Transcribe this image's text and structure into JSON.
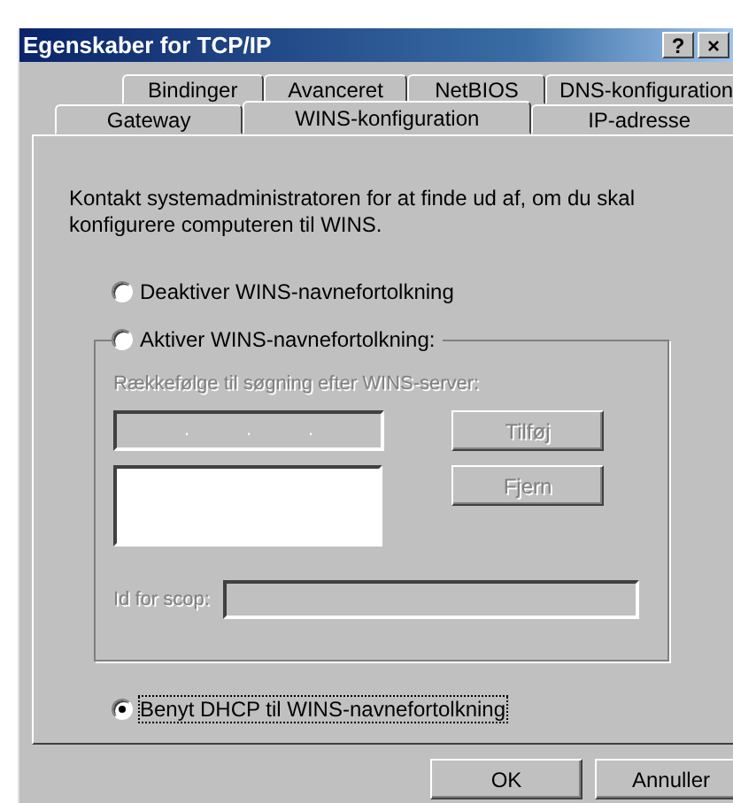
{
  "window": {
    "title": "Egenskaber for TCP/IP",
    "help_button": "?",
    "close_button": "×"
  },
  "tabs": [
    [
      {
        "label": "Bindinger",
        "selected": false
      },
      {
        "label": "Avanceret",
        "selected": false
      },
      {
        "label": "NetBIOS",
        "selected": false
      },
      {
        "label": "DNS-konfiguration",
        "selected": false
      }
    ],
    [
      {
        "label": "Gateway",
        "selected": false
      },
      {
        "label": "WINS-konfiguration",
        "selected": true
      },
      {
        "label": "IP-adresse",
        "selected": false
      }
    ]
  ],
  "intro": "Kontakt systemadministratoren for at finde ud af, om du skal konfigurere computeren til WINS.",
  "radios": [
    {
      "label": "Deaktiver WINS-navnefortolkning",
      "selected": false
    },
    {
      "label": "Aktiver WINS-navnefortolkning:",
      "selected": false
    }
  ],
  "wins_group": {
    "disabled": true,
    "server_label": "Rækkefølge til søgning efter WINS-server:",
    "ip_dots": [
      ".",
      ".",
      "."
    ],
    "add_button": "Tilføj",
    "remove_button": "Fjern",
    "scope_label": "Id for scop:"
  },
  "dhcp_radio": {
    "label": "Benyt DHCP til WINS-navnefortolkning",
    "selected": true
  },
  "buttons": [
    "OK",
    "Annuller"
  ]
}
